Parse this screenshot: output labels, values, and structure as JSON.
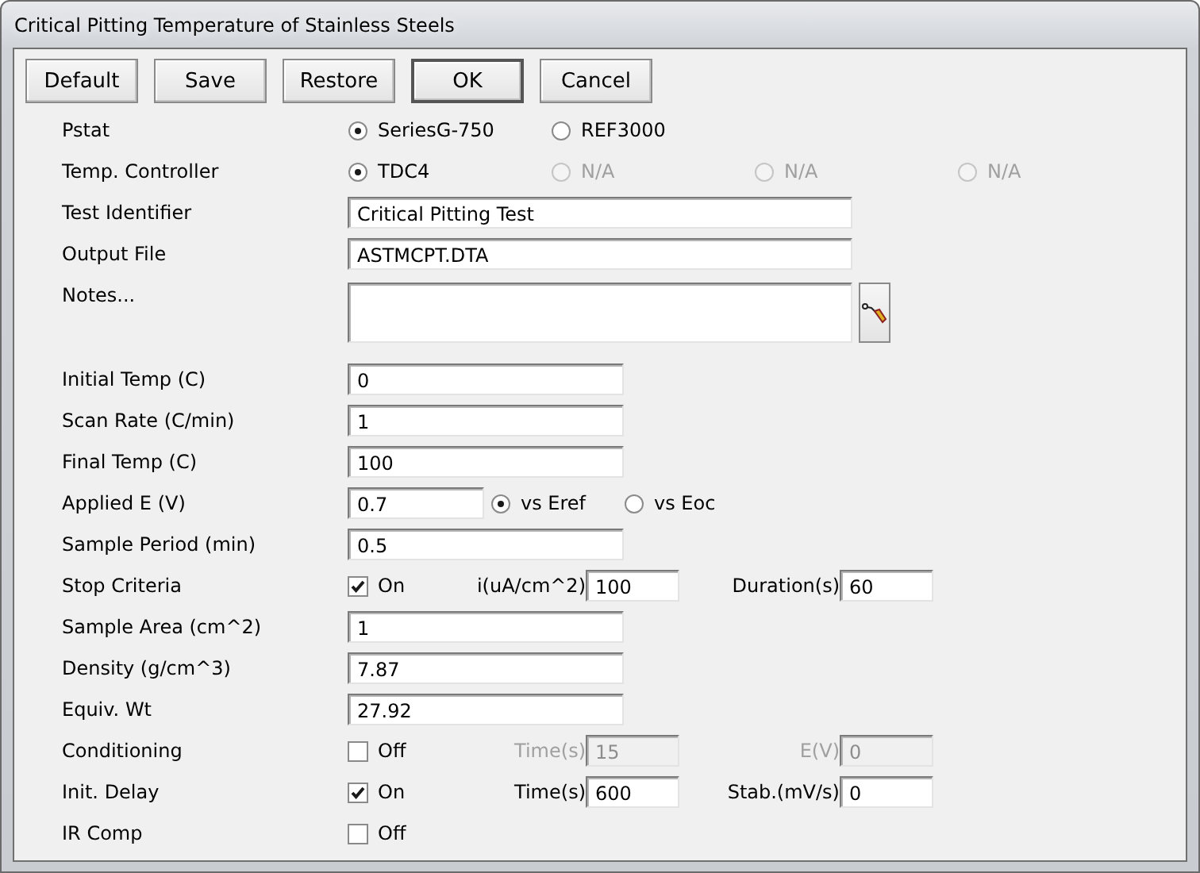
{
  "window": {
    "title": "Critical Pitting Temperature of Stainless Steels"
  },
  "buttons": [
    {
      "label": "Default",
      "default": false
    },
    {
      "label": "Save",
      "default": false
    },
    {
      "label": "Restore",
      "default": false
    },
    {
      "label": "OK",
      "default": true
    },
    {
      "label": "Cancel",
      "default": false
    }
  ],
  "rows": [
    {
      "kind": "radio",
      "label": "Pstat",
      "options": [
        {
          "label": "SeriesG-750",
          "selected": true,
          "disabled": false
        },
        {
          "label": "REF3000",
          "selected": false,
          "disabled": false
        }
      ]
    },
    {
      "kind": "radio",
      "label": "Temp. Controller",
      "options": [
        {
          "label": "TDC4",
          "selected": true,
          "disabled": false
        },
        {
          "label": "N/A",
          "selected": false,
          "disabled": true
        },
        {
          "label": "N/A",
          "selected": false,
          "disabled": true
        },
        {
          "label": "N/A",
          "selected": false,
          "disabled": true
        }
      ]
    },
    {
      "kind": "long_text",
      "label": "Test Identifier",
      "value": "Critical Pitting Test"
    },
    {
      "kind": "long_text",
      "label": "Output File",
      "value": "ASTMCPT.DTA"
    },
    {
      "kind": "notes",
      "label": "Notes..."
    },
    {
      "kind": "text",
      "label": "Initial Temp (C)",
      "value": "0"
    },
    {
      "kind": "text",
      "label": "Scan Rate (C/min)",
      "value": "1"
    },
    {
      "kind": "text",
      "label": "Final Temp (C)",
      "value": "100"
    },
    {
      "kind": "text_radio",
      "label": "Applied E (V)",
      "value": "0.7",
      "options": [
        {
          "label": "vs Eref",
          "selected": true,
          "disabled": false
        },
        {
          "label": "vs Eoc",
          "selected": false,
          "disabled": false
        }
      ]
    },
    {
      "kind": "text",
      "label": "Sample Period (min)",
      "value": "0.5"
    },
    {
      "kind": "check_params",
      "label": "Stop Criteria",
      "checked": true,
      "check_label": "On",
      "params": [
        {
          "label": "i(uA/cm^2)",
          "value": "100",
          "disabled": false
        },
        {
          "label": "Duration(s)",
          "value": "60",
          "disabled": false
        }
      ]
    },
    {
      "kind": "text",
      "label": "Sample Area (cm^2)",
      "value": "1"
    },
    {
      "kind": "text",
      "label": "Density (g/cm^3)",
      "value": "7.87"
    },
    {
      "kind": "text",
      "label": "Equiv. Wt",
      "value": "27.92"
    },
    {
      "kind": "check_params",
      "label": "Conditioning",
      "checked": false,
      "check_label": "Off",
      "params": [
        {
          "label": "Time(s)",
          "value": "15",
          "disabled": true
        },
        {
          "label": "E(V)",
          "value": "0",
          "disabled": true
        }
      ]
    },
    {
      "kind": "check_params",
      "label": "Init. Delay",
      "checked": true,
      "check_label": "On",
      "params": [
        {
          "label": "Time(s)",
          "value": "600",
          "disabled": false
        },
        {
          "label": "Stab.(mV/s)",
          "value": "0",
          "disabled": false
        }
      ]
    },
    {
      "kind": "check",
      "label": "IR Comp",
      "checked": false,
      "check_label": "Off"
    }
  ]
}
